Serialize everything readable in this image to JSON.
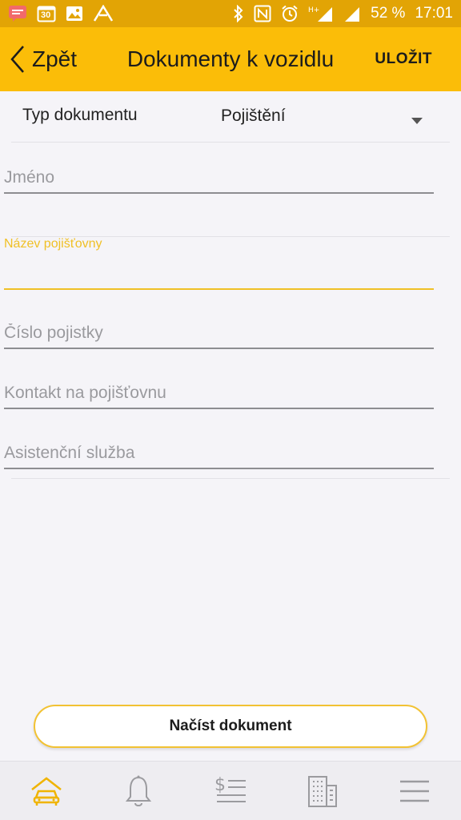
{
  "status_bar": {
    "calendar_day": "30",
    "battery_percent": "52 %",
    "time": "17:01"
  },
  "app_bar": {
    "back_label": "Zpět",
    "title": "Dokumenty k vozidlu",
    "save_label": "ULOŽIT"
  },
  "document_type": {
    "label": "Typ dokumentu",
    "selected": "Pojištění"
  },
  "fields": {
    "name_placeholder": "Jméno",
    "insurer_label": "Název pojišťovny",
    "insurer_value": "",
    "policy_placeholder": "Číslo pojistky",
    "contact_placeholder": "Kontakt na pojišťovnu",
    "assistance_placeholder": "Asistenční služba"
  },
  "load_button": {
    "label": "Načíst dokument"
  },
  "colors": {
    "accent": "#fbbd08",
    "status_bar": "#e2a405",
    "focus": "#f0c026",
    "nav_active": "#f0b400",
    "nav_inactive": "#9b9b9f"
  },
  "bottom_nav": {
    "items": [
      "car-home-icon",
      "bell-icon",
      "dollar-list-icon",
      "building-icon",
      "menu-icon"
    ],
    "active": "car-home-icon"
  }
}
